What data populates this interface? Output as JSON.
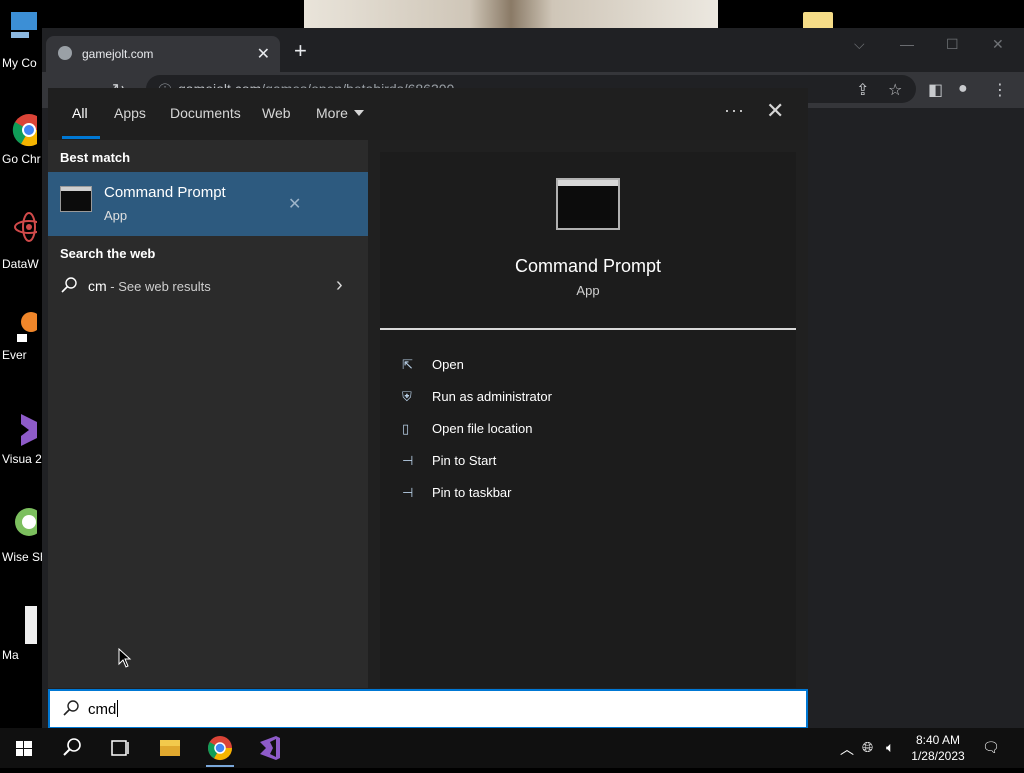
{
  "desktop": {
    "icons": [
      {
        "label": "My Co"
      },
      {
        "label": "Go Chr"
      },
      {
        "label": "DataW"
      },
      {
        "label": "Ever"
      },
      {
        "label": "Visua 2"
      },
      {
        "label": "Wise Shut"
      },
      {
        "label": "Ma"
      }
    ]
  },
  "browser": {
    "tab_title": "gamejolt.com",
    "new_tab": "+",
    "url_host": "gamejolt.com",
    "url_path": "/games/open/betabirds/686300"
  },
  "search": {
    "tabs": [
      "All",
      "Apps",
      "Documents",
      "Web",
      "More"
    ],
    "active_tab": "All",
    "best_match_heading": "Best match",
    "best_match": {
      "title": "Command Prompt",
      "subtitle": "App"
    },
    "web_heading": "Search the web",
    "web_query": "cm",
    "web_suffix": " - See web results",
    "preview": {
      "title": "Command Prompt",
      "subtitle": "App"
    },
    "actions": [
      {
        "label": "Open",
        "icon": "open-icon"
      },
      {
        "label": "Run as administrator",
        "icon": "shield-icon"
      },
      {
        "label": "Open file location",
        "icon": "file-location-icon"
      },
      {
        "label": "Pin to Start",
        "icon": "pin-icon"
      },
      {
        "label": "Pin to taskbar",
        "icon": "pin-icon"
      }
    ],
    "query": "cmd"
  },
  "taskbar": {
    "time": "8:40 AM",
    "date": "1/28/2023"
  },
  "colors": {
    "accent": "#0078d4",
    "selected_item": "#2d5a7f"
  }
}
